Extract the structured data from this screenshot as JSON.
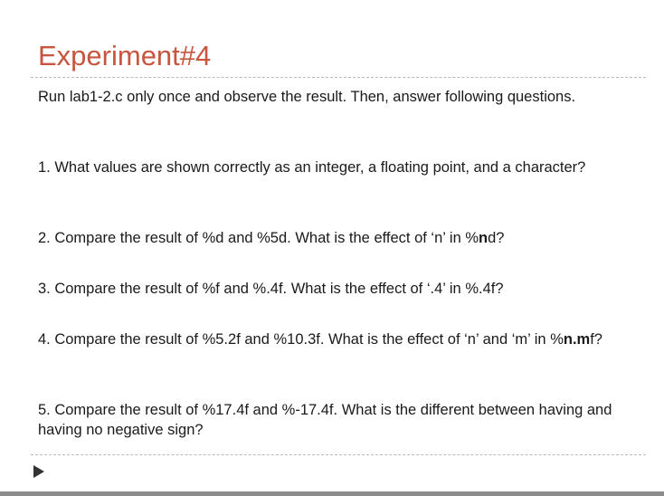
{
  "slide": {
    "title": "Experiment#4",
    "intro": "Run lab1-2.c only once and observe the result. Then, answer following questions.",
    "q1": "1. What values are shown correctly as an integer, a floating point, and a character?",
    "q2_text": "2. Compare the result of %d and %5d. What is the effect of ‘n’ in %",
    "q2_bold": "n",
    "q2_end": "d?",
    "q3": "3. Compare the result of %f and %.4f. What is the effect of ‘.4’ in %.4f?",
    "q4_text": "4. Compare the result of %5.2f and %10.3f. What is the effect of ‘n’ and ‘m’ in %",
    "q4_bold": "n.m",
    "q4_end": "f?",
    "q5": "5. Compare the result of %17.4f and %-17.4f. What is the different between having and having no negative sign?"
  },
  "navigation": {
    "next_icon": "play-arrow-icon"
  }
}
